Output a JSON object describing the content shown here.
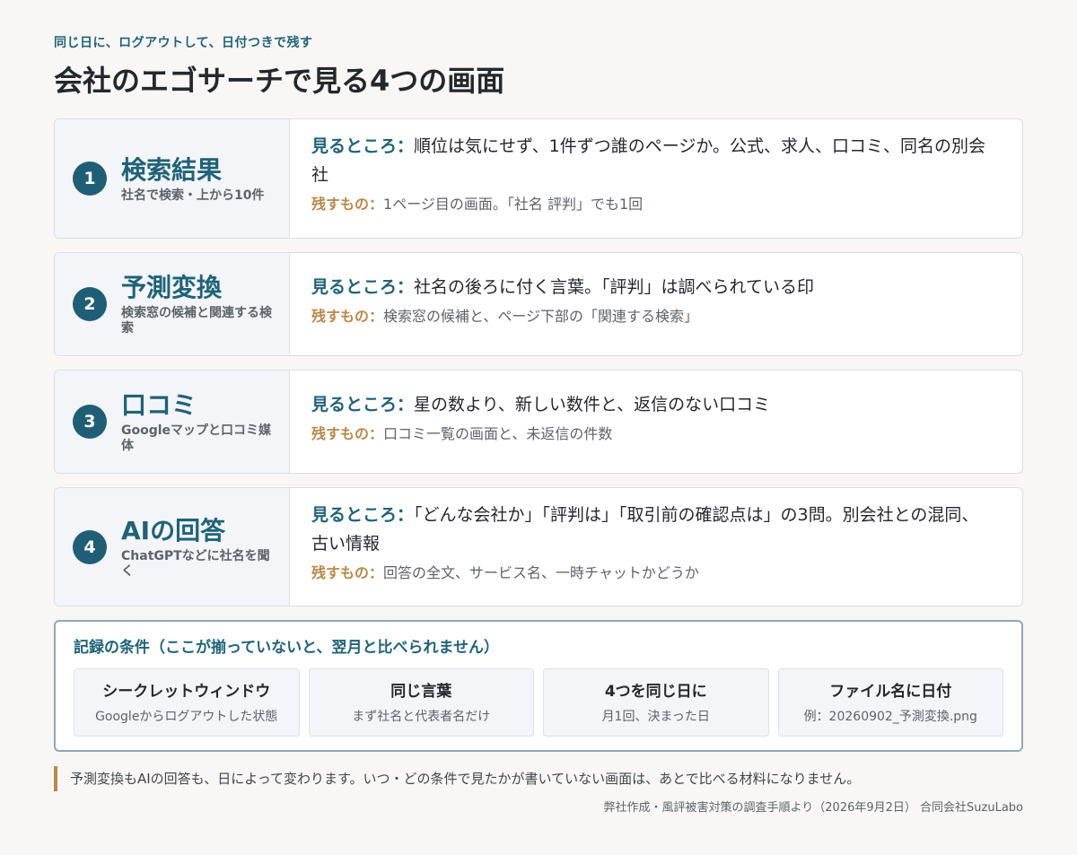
{
  "header": {
    "eyebrow": "同じ日に、ログアウトして、日付つきで残す",
    "title": "会社のエゴサーチで見る4つの画面"
  },
  "labels": {
    "see": "見るところ：",
    "keep": "残すもの："
  },
  "cards": [
    {
      "num": "1",
      "title": "検索結果",
      "subtitle": "社名で検索・上から10件",
      "see": "順位は気にせず、1件ずつ誰のページか。公式、求人、口コミ、同名の別会社",
      "keep": "1ページ目の画面。「社名 評判」でも1回"
    },
    {
      "num": "2",
      "title": "予測変換",
      "subtitle": "検索窓の候補と関連する検索",
      "see": "社名の後ろに付く言葉。「評判」は調べられている印",
      "keep": "検索窓の候補と、ページ下部の「関連する検索」"
    },
    {
      "num": "3",
      "title": "口コミ",
      "subtitle": "Googleマップと口コミ媒体",
      "see": "星の数より、新しい数件と、返信のない口コミ",
      "keep": "口コミ一覧の画面と、未返信の件数"
    },
    {
      "num": "4",
      "title": "AIの回答",
      "subtitle": "ChatGPTなどに社名を聞く",
      "see": "「どんな会社か」「評判は」「取引前の確認点は」の3問。別会社との混同、古い情報",
      "keep": "回答の全文、サービス名、一時チャットかどうか"
    }
  ],
  "conditions": {
    "title": "記録の条件（ここが揃っていないと、翌月と比べられません）",
    "items": [
      {
        "heading": "シークレットウィンドウ",
        "desc": "Googleからログアウトした状態"
      },
      {
        "heading": "同じ言葉",
        "desc": "まず社名と代表者名だけ"
      },
      {
        "heading": "4つを同じ日に",
        "desc": "月1回、決まった日"
      },
      {
        "heading": "ファイル名に日付",
        "desc": "例：20260902_予測変換.png"
      }
    ]
  },
  "note": "予測変換もAIの回答も、日によって変わります。いつ・どの条件で見たかが書いていない画面は、あとで比べる材料になりません。",
  "footer": "弊社作成・風評被害対策の調査手順より（2026年9月2日） 合同会社SuzuLabo",
  "colors": {
    "accent": "#1f6378",
    "badge": "#1f5f75",
    "keep_label": "#b9894b",
    "background": "#f8f7f5"
  }
}
